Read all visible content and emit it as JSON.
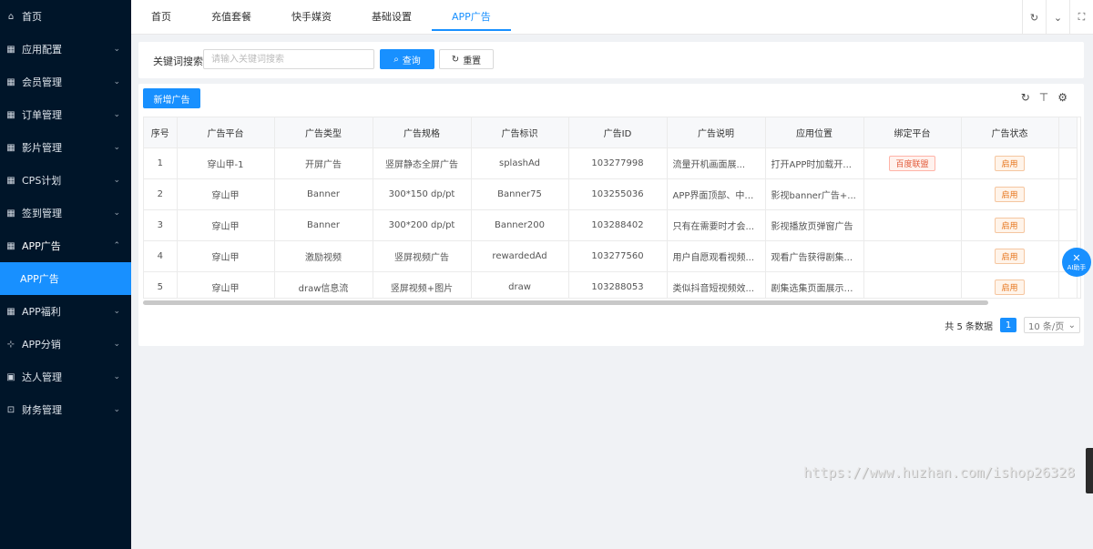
{
  "sidebar": {
    "items": [
      {
        "label": "首页",
        "icon": "home-icon",
        "glyph": "⌂",
        "chevron": ""
      },
      {
        "label": "应用配置",
        "icon": "grid-icon",
        "glyph": "▦",
        "chevron": "⌄"
      },
      {
        "label": "会员管理",
        "icon": "grid-icon",
        "glyph": "▦",
        "chevron": "⌄"
      },
      {
        "label": "订单管理",
        "icon": "grid-icon",
        "glyph": "▦",
        "chevron": "⌄"
      },
      {
        "label": "影片管理",
        "icon": "grid-icon",
        "glyph": "▦",
        "chevron": "⌄"
      },
      {
        "label": "CPS计划",
        "icon": "grid-icon",
        "glyph": "▦",
        "chevron": "⌄"
      },
      {
        "label": "签到管理",
        "icon": "grid-icon",
        "glyph": "▦",
        "chevron": "⌄"
      },
      {
        "label": "APP广告",
        "icon": "grid-icon",
        "glyph": "▦",
        "chevron": "⌃"
      },
      {
        "label": "APP广告",
        "icon": "",
        "glyph": "",
        "chevron": ""
      },
      {
        "label": "APP福利",
        "icon": "grid-icon",
        "glyph": "▦",
        "chevron": "⌄"
      },
      {
        "label": "APP分销",
        "icon": "sitemap-icon",
        "glyph": "⊹",
        "chevron": "⌄"
      },
      {
        "label": "达人管理",
        "icon": "card-icon",
        "glyph": "▣",
        "chevron": "⌄"
      },
      {
        "label": "财务管理",
        "icon": "wallet-icon",
        "glyph": "⊡",
        "chevron": "⌄"
      }
    ]
  },
  "tabs": [
    "首页",
    "充值套餐",
    "快手媒资",
    "基础设置",
    "APP广告"
  ],
  "top_controls": {
    "refresh": "↻",
    "dropdown": "⌄",
    "fullscreen": "⛶"
  },
  "search": {
    "label": "关键词搜索:",
    "placeholder": "请输入关键词搜索",
    "query_label": "查询",
    "reset_label": "重置"
  },
  "toolbar": {
    "add_label": "新增广告"
  },
  "table": {
    "headers": [
      "序号",
      "广告平台",
      "广告类型",
      "广告规格",
      "广告标识",
      "广告ID",
      "广告说明",
      "应用位置",
      "绑定平台",
      "广告状态"
    ],
    "rows": [
      [
        "1",
        "穿山甲-1",
        "开屏广告",
        "竖屏静态全屏广告",
        "splashAd",
        "103277998",
        "流量开机画面展...",
        "打开APP时加载开...",
        "百度联盟",
        "启用"
      ],
      [
        "2",
        "穿山甲",
        "Banner",
        "300*150 dp/pt",
        "Banner75",
        "103255036",
        "APP界面顶部、中部...",
        "影视banner广告+...",
        "",
        "启用"
      ],
      [
        "3",
        "穿山甲",
        "Banner",
        "300*200 dp/pt",
        "Banner200",
        "103288402",
        "只有在需要时才会...",
        "影视播放页弹窗广告",
        "",
        "启用"
      ],
      [
        "4",
        "穿山甲",
        "激励视频",
        "竖屏视频广告",
        "rewardedAd",
        "103277560",
        "用户自愿观看视频...",
        "观看广告获得剧集...",
        "",
        "启用"
      ],
      [
        "5",
        "穿山甲",
        "draw信息流",
        "竖屏视频+图片",
        "draw",
        "103288053",
        "类似抖音短视频效...",
        "剧集选集页面展示后...",
        "",
        "启用"
      ]
    ]
  },
  "pagination": {
    "total": "共 5 条数据",
    "current": "1",
    "size": "10 条/页"
  },
  "ai_helper": {
    "label": "AI助手"
  },
  "watermark": "https://www.huzhan.com/ishop26328",
  "colors": {
    "primary": "#1890ff",
    "sidebar": "#001529"
  }
}
